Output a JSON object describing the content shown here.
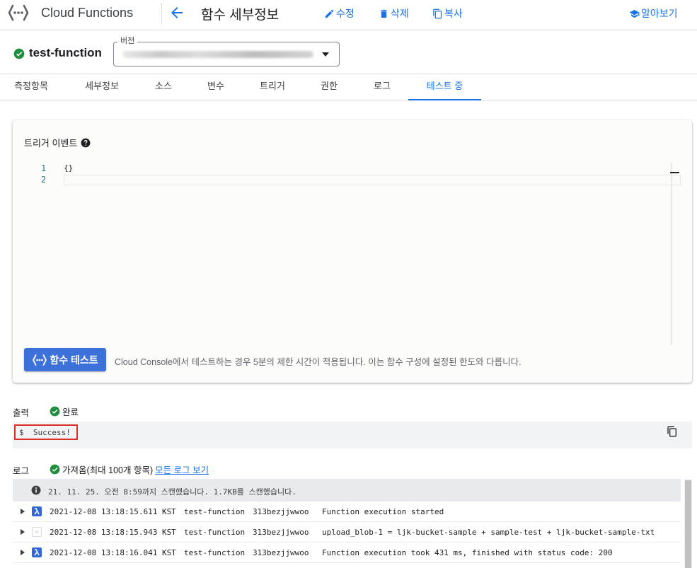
{
  "header": {
    "app_title": "Cloud Functions",
    "page_title": "함수 세부정보",
    "edit_label": "수정",
    "delete_label": "삭제",
    "copy_label": "복사",
    "learn_label": "알아보기"
  },
  "function": {
    "name": "test-function",
    "version_label": "버전"
  },
  "tabs": [
    {
      "label": "측정항목"
    },
    {
      "label": "세부정보"
    },
    {
      "label": "소스"
    },
    {
      "label": "변수"
    },
    {
      "label": "트리거"
    },
    {
      "label": "권한"
    },
    {
      "label": "로그"
    },
    {
      "label": "테스트 중"
    }
  ],
  "trigger": {
    "title": "트리거 이벤트",
    "lines": [
      "1",
      "2"
    ],
    "code": "{}"
  },
  "test_button": {
    "label": "함수 테스트"
  },
  "note": "Cloud Console에서 테스트하는 경우 5분의 제한 시간이 적용됩니다. 이는 함수 구성에 설정된 한도와 다릅니다.",
  "output": {
    "label": "출력",
    "status": "완료",
    "text": "$  Success!"
  },
  "logs": {
    "label": "로그",
    "status": "가져옴(최대 100개 항목)",
    "link": "모든 로그 보기",
    "info": "21. 11. 25. 오전 8:59까지 스캔했습니다. 1.7KB를 스캔했습니다.",
    "rows": [
      {
        "time": "2021-12-08 13:18:15.611 KST",
        "fn": "test-function",
        "id": "313bezjjwwoo",
        "msg": "Function execution started",
        "sev": "lambda"
      },
      {
        "time": "2021-12-08 13:18:15.943 KST",
        "fn": "test-function",
        "id": "313bezjjwwoo",
        "msg": "upload_blob-1 = ljk-bucket-sample + sample-test + ljk-bucket-sample-txt",
        "sev": "default"
      },
      {
        "time": "2021-12-08 13:18:16.041 KST",
        "fn": "test-function",
        "id": "313bezjjwwoo",
        "msg": "Function execution took 431 ms, finished with status code: 200",
        "sev": "lambda"
      }
    ]
  },
  "colors": {
    "accent": "#1a73e8",
    "success": "#1e8e3e",
    "button": "#3c71da",
    "highlight": "#d93025"
  }
}
